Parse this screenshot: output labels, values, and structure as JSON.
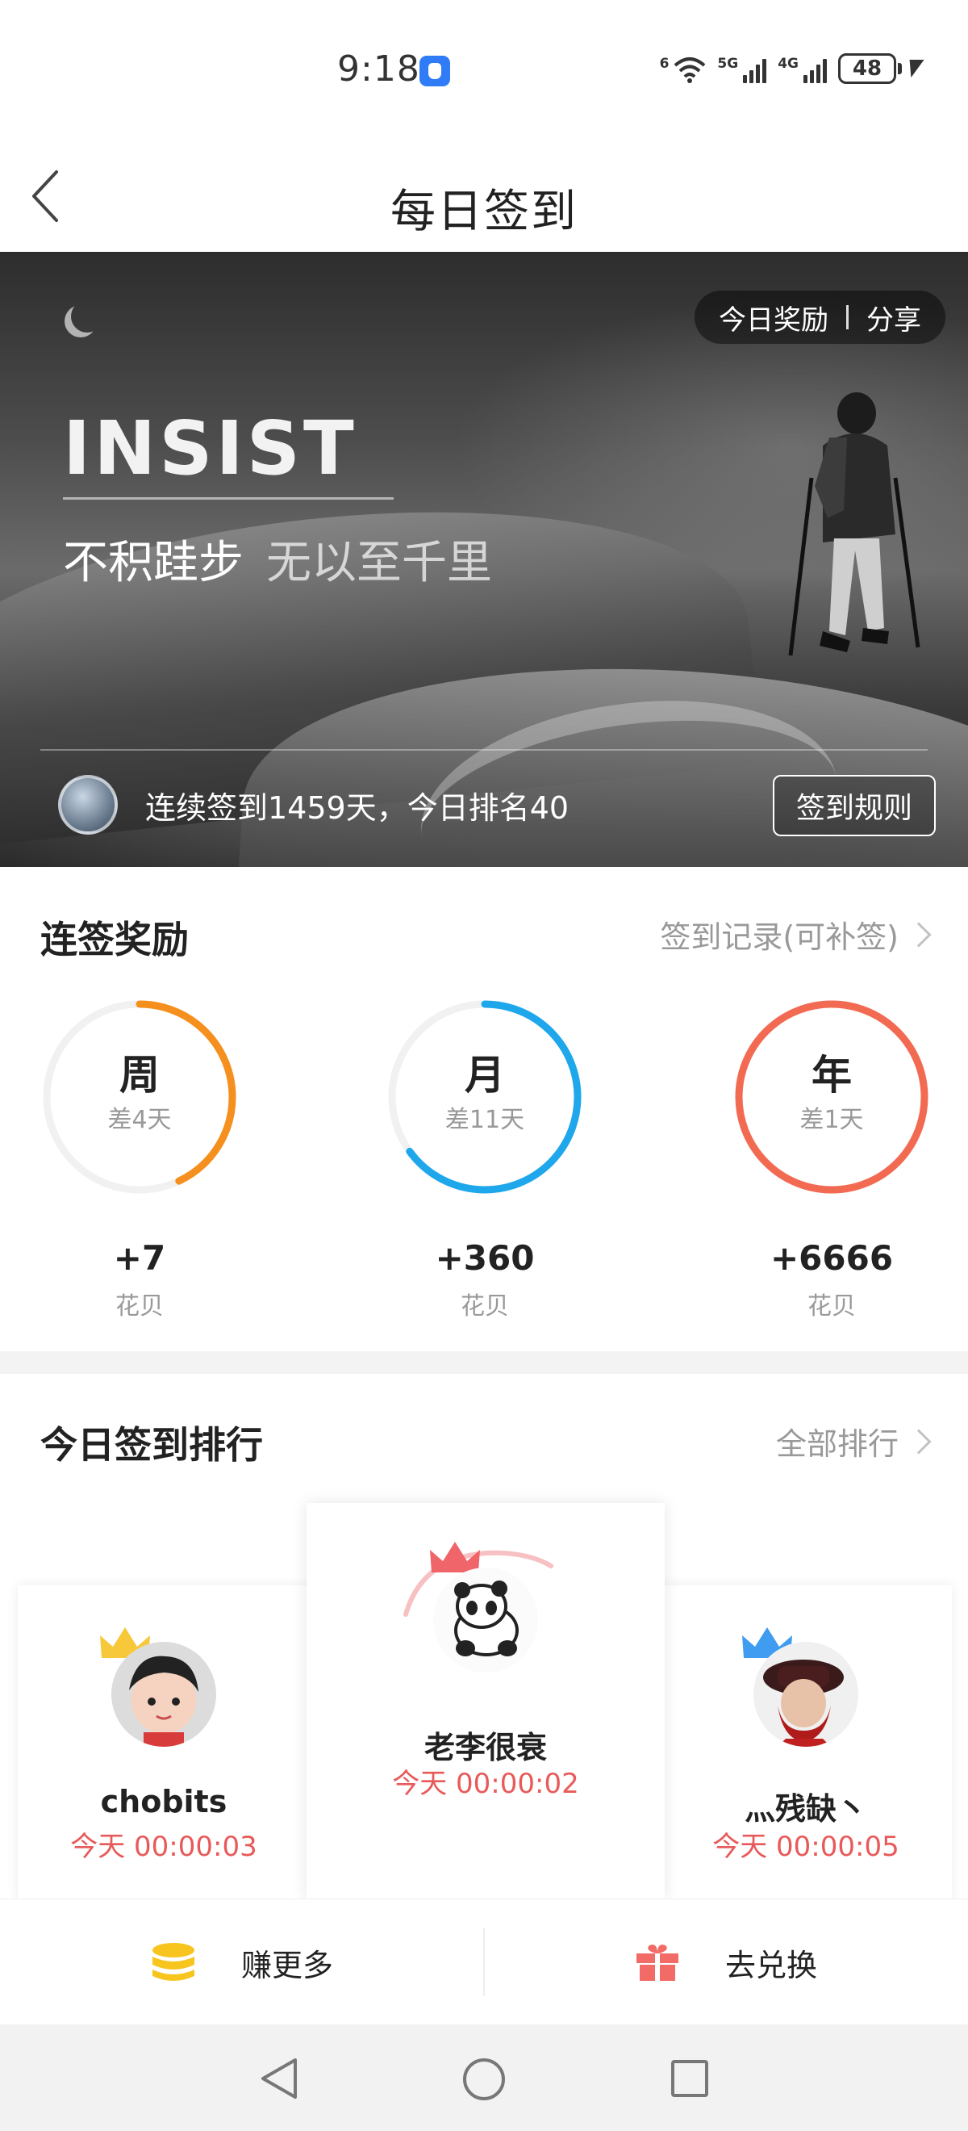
{
  "status_bar": {
    "time": "9:18",
    "wifi_tag": "6",
    "sim1_tag": "5G",
    "sim2_tag": "4G",
    "battery": "48"
  },
  "header": {
    "title": "每日签到",
    "back_icon": "chevron-left-icon"
  },
  "hero": {
    "reward_link": "今日奖励",
    "share_link": "分享",
    "headline": "INSIST",
    "motto_main": "不积跬步",
    "motto_sub": "无以至千里",
    "streak_text": "连续签到1459天，今日排名40",
    "rules_button": "签到规则"
  },
  "rewards": {
    "title": "连签奖励",
    "record_link": "签到记录(可补签)",
    "items": [
      {
        "label": "周",
        "remaining": "差4天",
        "value": "+7",
        "unit": "花贝",
        "color": "#f5901e",
        "progress": 0.43
      },
      {
        "label": "月",
        "remaining": "差11天",
        "value": "+360",
        "unit": "花贝",
        "color": "#1fa7ec",
        "progress": 0.65
      },
      {
        "label": "年",
        "remaining": "差1天",
        "value": "+6666",
        "unit": "花贝",
        "color": "#f36a52",
        "progress": 0.997
      }
    ]
  },
  "ranking": {
    "title": "今日签到排行",
    "all_link": "全部排行",
    "entries": [
      {
        "rank": 1,
        "name": "老李很衰",
        "time": "今天 00:00:02",
        "crown_color": "#f0656a"
      },
      {
        "rank": 2,
        "name": "chobits",
        "time": "今天 00:00:03",
        "crown_color": "#f6c83a"
      },
      {
        "rank": 3,
        "name": "灬残缺丶",
        "time": "今天 00:00:05",
        "crown_color": "#3f9cf0"
      }
    ]
  },
  "actions": {
    "earn": "赚更多",
    "exchange": "去兑换",
    "earn_icon": "coins-icon",
    "exchange_icon": "gift-icon"
  },
  "colors": {
    "accent_red": "#e85a5a",
    "muted_text": "#999999"
  }
}
